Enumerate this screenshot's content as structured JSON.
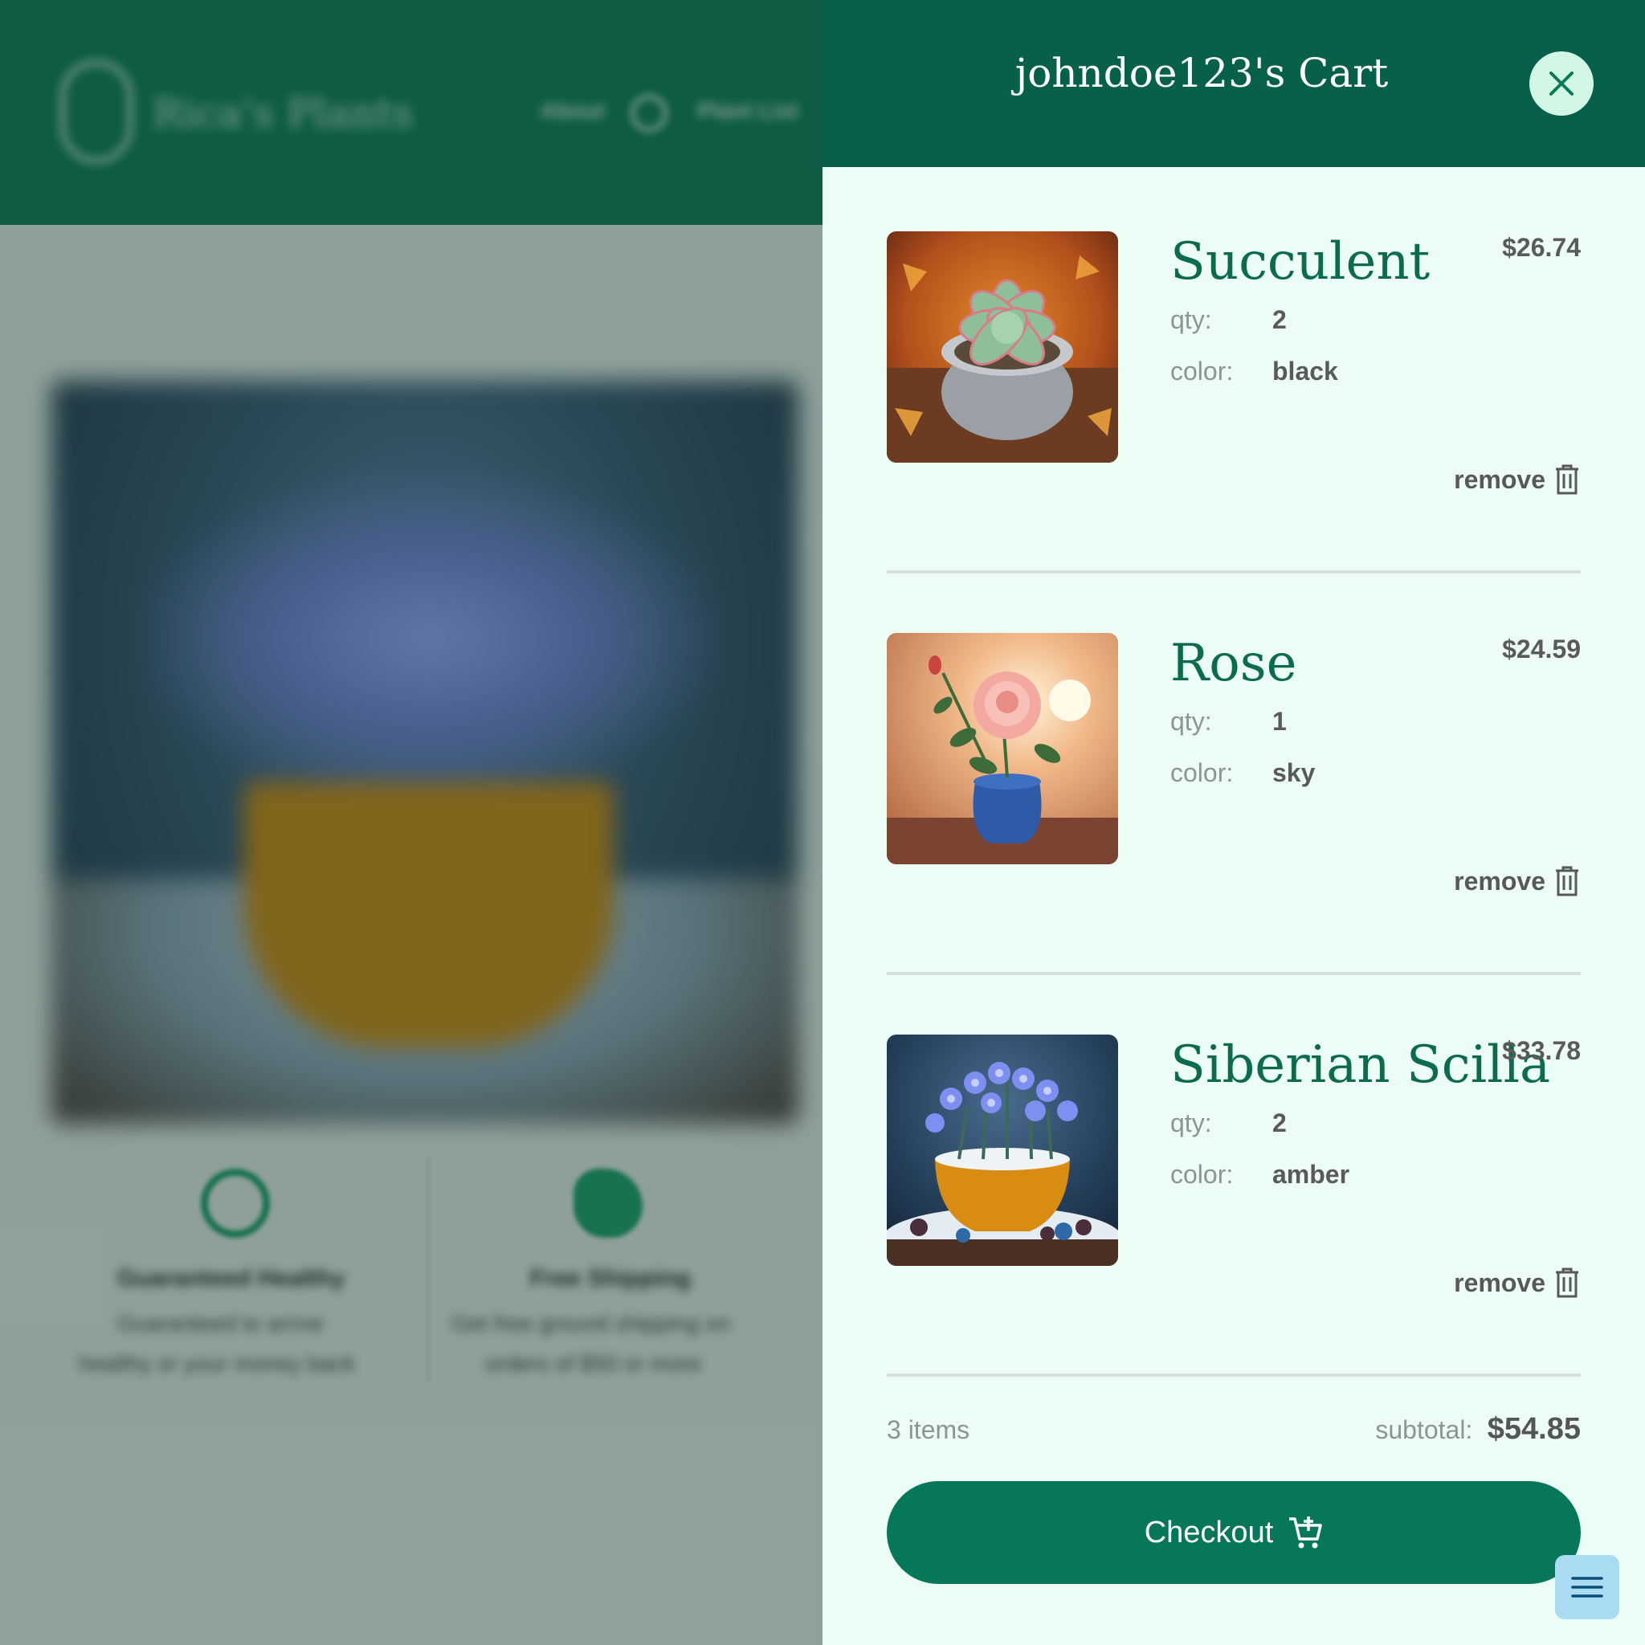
{
  "background": {
    "brand": "Rica's Plants",
    "nav": [
      "About",
      "Plant List"
    ],
    "features": [
      {
        "title": "Guaranteed Healthy",
        "lines": [
          "Guaranteed to arrive",
          "healthy or your money back"
        ]
      },
      {
        "title": "Free Shipping",
        "lines": [
          "Get free ground shipping on",
          "orders of $50 or more"
        ]
      }
    ]
  },
  "cart": {
    "title": "johndoe123's Cart",
    "qty_label": "qty:",
    "color_label": "color:",
    "remove_label": "remove",
    "items": [
      {
        "name": "Succulent",
        "price": "$26.74",
        "qty": "2",
        "color": "black"
      },
      {
        "name": "Rose",
        "price": "$24.59",
        "qty": "1",
        "color": "sky"
      },
      {
        "name": "Siberian Scilla",
        "price": "$33.78",
        "qty": "2",
        "color": "amber"
      }
    ],
    "item_count": "3 items",
    "subtotal_label": "subtotal:",
    "subtotal": "$54.85",
    "checkout_label": "Checkout"
  },
  "icons": {
    "close": "close-icon",
    "trash": "trash-icon",
    "cart": "cart-icon",
    "menu": "menu-icon"
  },
  "colors": {
    "header": "#07604a",
    "accent": "#0a6b4f",
    "checkout": "#07775a",
    "drawer_bg": "#ecfdf6",
    "close_bg": "#d2f7e4"
  }
}
